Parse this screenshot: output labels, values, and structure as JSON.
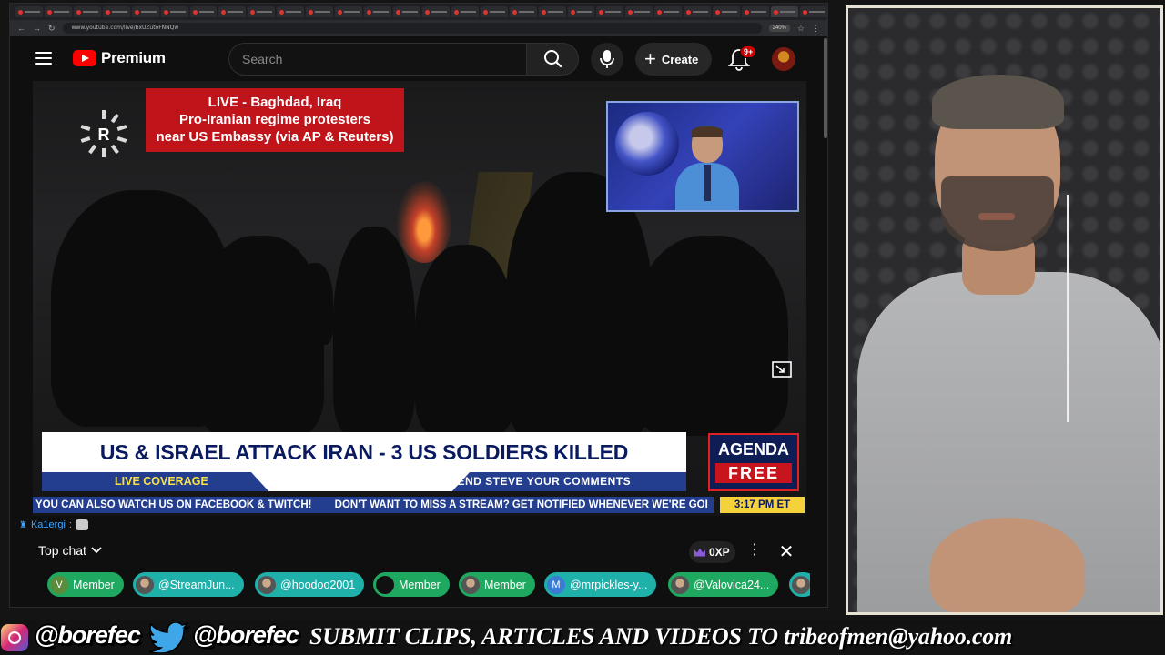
{
  "browser": {
    "url": "www.youtube.com/live/bxUZutoFNNQw",
    "zoom": "240%"
  },
  "header": {
    "logo_text": "Premium",
    "search_placeholder": "Search",
    "create_label": "Create",
    "notification_count": "9+"
  },
  "video": {
    "live_overlay_lines": [
      "LIVE - Baghdad, Iraq",
      "Pro-Iranian regime protesters",
      "near US Embassy (via AP & Reuters)"
    ],
    "channel_logo_letter": "R",
    "headline": "US & ISRAEL ATTACK IRAN - 3 US SOLDIERS KILLED",
    "live_coverage": "LIVE COVERAGE",
    "send_comments": "SEND STEVE YOUR COMMENTS",
    "agenda_logo_top": "AGENDA",
    "agenda_logo_bottom": "FREE",
    "ticker_1": "YOU CAN ALSO WATCH US ON FACEBOOK & TWITCH!",
    "ticker_2": "DON'T WANT TO MISS A STREAM? GET NOTIFIED WHENEVER WE'RE GOI",
    "ticker_time": "3:17 PM ET"
  },
  "chat": {
    "last_message_author": "Ka1ergi",
    "last_message_sep": ":",
    "mode_label": "Top chat",
    "xp_label": "0XP",
    "gifts": [
      {
        "avatar": "V",
        "label": "Member"
      },
      {
        "avatar": "",
        "label": "@StreamJun..."
      },
      {
        "avatar": "",
        "label": "@hoodoo2001"
      },
      {
        "avatar": "",
        "label": "Member"
      },
      {
        "avatar": "",
        "label": "Member"
      },
      {
        "avatar": "M",
        "label": "@mrpickles-y..."
      },
      {
        "avatar": "",
        "label": "@Valovica24..."
      }
    ]
  },
  "banner": {
    "instagram_handle": "@borefec",
    "twitter_handle": "@borefec",
    "submit_text": "SUBMIT CLIPS, ARTICLES AND VIDEOS TO tribeofmen@yahoo.com"
  },
  "colors": {
    "youtube_red": "#ff0000",
    "live_red": "#c0141b",
    "headline_navy": "#0a1a5e",
    "ticker_blue": "#233d8f",
    "live_coverage_yellow": "#f8e24a",
    "member_green": "#1fa85f",
    "gift_cyan": "#1fb0aa"
  },
  "icons": [
    "menu-icon",
    "youtube-logo-icon",
    "search-icon",
    "mic-icon",
    "plus-icon",
    "bell-icon",
    "miniplayer-icon",
    "chevron-down-icon",
    "crown-icon",
    "more-vert-icon",
    "close-icon",
    "instagram-icon",
    "twitter-bird-icon"
  ]
}
